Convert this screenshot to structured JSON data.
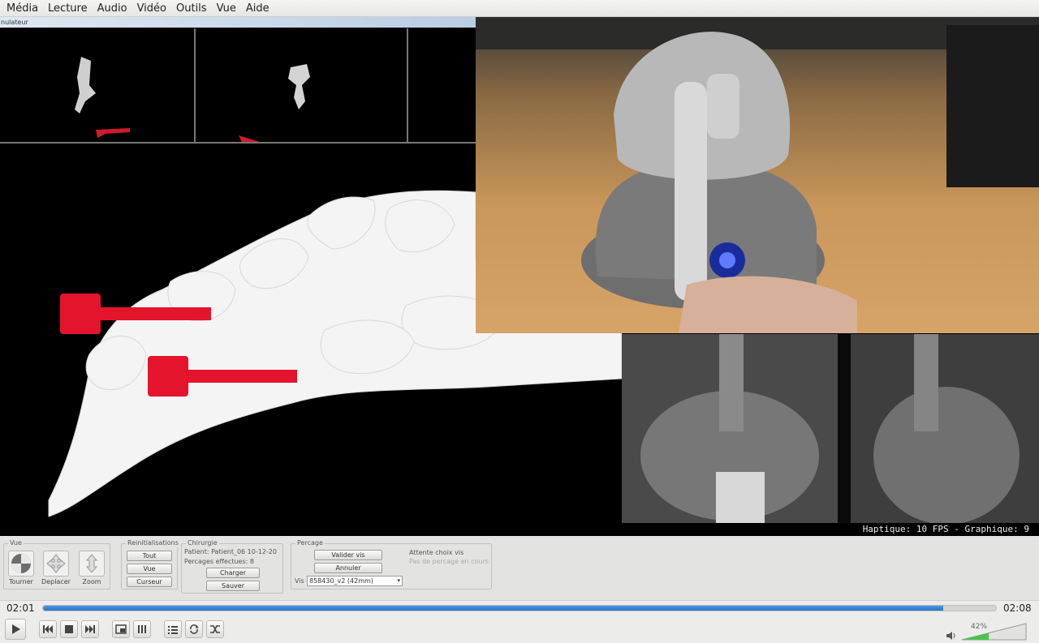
{
  "menubar": {
    "items": [
      "Média",
      "Lecture",
      "Audio",
      "Vidéo",
      "Outils",
      "Vue",
      "Aide"
    ]
  },
  "simulator": {
    "window_title": "nulateur",
    "status_line": "Haptique:  10 FPS - Graphique:   9"
  },
  "panel": {
    "vue": {
      "title": "Vue",
      "tools": [
        "Tourner",
        "Deplacer",
        "Zoom"
      ]
    },
    "reinit": {
      "title": "Reinitialisations",
      "buttons": [
        "Tout",
        "Vue",
        "Curseur"
      ]
    },
    "chirurgie": {
      "title": "Chirurgie",
      "patient": "Patient: Patient_06 10-12-20",
      "percages": "Percages effectues: 8",
      "buttons": [
        "Charger",
        "Sauver"
      ]
    },
    "percage": {
      "title": "Percage",
      "buttons": [
        "Valider vis",
        "Annuler"
      ],
      "status1": "Attente choix vis",
      "status2": "Pas de percage en cours",
      "vis_label": "Vis",
      "vis_value": "858430_v2 (42mm)"
    }
  },
  "player": {
    "elapsed": "02:01",
    "total": "02:08",
    "progress": 0.945,
    "volume_label": "42%",
    "volume": 0.42
  },
  "colors": {
    "accent": "#2a74c9",
    "screw": "#e3142b"
  }
}
